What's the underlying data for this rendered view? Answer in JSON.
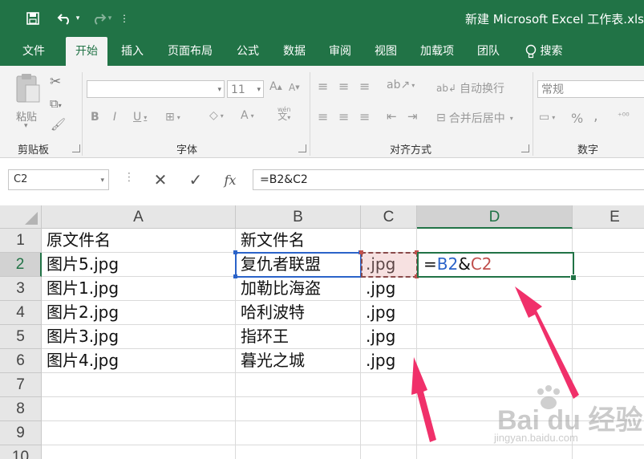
{
  "window": {
    "title": "新建 Microsoft Excel 工作表.xlsx"
  },
  "tabs": [
    {
      "label": "文件",
      "active": false
    },
    {
      "label": "开始",
      "active": true
    },
    {
      "label": "插入",
      "active": false
    },
    {
      "label": "页面布局",
      "active": false
    },
    {
      "label": "公式",
      "active": false
    },
    {
      "label": "数据",
      "active": false
    },
    {
      "label": "审阅",
      "active": false
    },
    {
      "label": "视图",
      "active": false
    },
    {
      "label": "加载项",
      "active": false
    },
    {
      "label": "团队",
      "active": false
    }
  ],
  "search_label": "搜索",
  "ribbon": {
    "clipboard": {
      "paste_label": "粘贴",
      "group_label": "剪贴板"
    },
    "font": {
      "font_name": "",
      "font_size": "11",
      "group_label": "字体",
      "wen_label": "wén"
    },
    "alignment": {
      "wrap_label": "自动换行",
      "merge_label": "合并后居中",
      "group_label": "对齐方式"
    },
    "number": {
      "format_value": "常规",
      "percent": "%",
      "comma": ",",
      "group_label": "数字"
    }
  },
  "formula_bar": {
    "name_box": "C2",
    "formula": "=B2&C2",
    "fx_label": "fx"
  },
  "columns": [
    "A",
    "B",
    "C",
    "D",
    "E"
  ],
  "selected_column": "D",
  "rows": [
    {
      "num": "1",
      "a": "原文件名",
      "b": "新文件名",
      "c": "",
      "d": ""
    },
    {
      "num": "2",
      "a": "图片5.jpg",
      "b": "复仇者联盟",
      "c": ".jpg",
      "d": ""
    },
    {
      "num": "3",
      "a": "图片1.jpg",
      "b": "加勒比海盗",
      "c": ".jpg",
      "d": ""
    },
    {
      "num": "4",
      "a": "图片2.jpg",
      "b": "哈利波特",
      "c": ".jpg",
      "d": ""
    },
    {
      "num": "5",
      "a": "图片3.jpg",
      "b": "指环王",
      "c": ".jpg",
      "d": ""
    },
    {
      "num": "6",
      "a": "图片4.jpg",
      "b": "暮光之城",
      "c": ".jpg",
      "d": ""
    },
    {
      "num": "7",
      "a": "",
      "b": "",
      "c": "",
      "d": ""
    },
    {
      "num": "8",
      "a": "",
      "b": "",
      "c": "",
      "d": ""
    },
    {
      "num": "9",
      "a": "",
      "b": "",
      "c": "",
      "d": ""
    },
    {
      "num": "10",
      "a": "",
      "b": "",
      "c": "",
      "d": ""
    }
  ],
  "selected_row": "2",
  "editing_cell": {
    "eq": "=",
    "ref1": "B2",
    "amp": "&",
    "ref2": "C2"
  },
  "colors": {
    "accent": "#217346",
    "ref_blue": "#2b63c9",
    "ref_red": "#c0504d",
    "arrow": "#f0306a"
  },
  "watermark": {
    "main": "Bai du 经验",
    "sub": "jingyan.baidu.com"
  }
}
